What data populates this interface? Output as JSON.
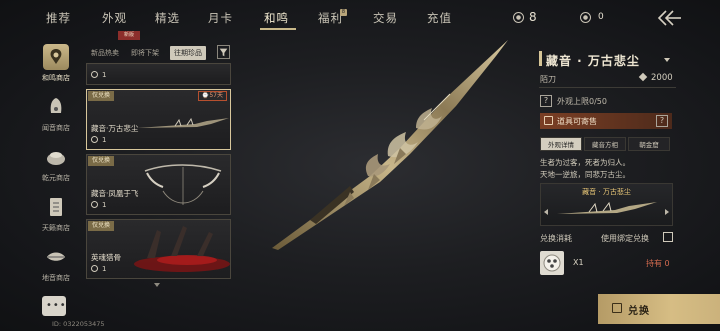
{
  "nav": {
    "tabs": [
      "推荐",
      "外观",
      "精选",
      "月卡",
      "和鸣",
      "福利",
      "交易",
      "充值"
    ],
    "active_tab": "和鸣",
    "welfare_badge": "8",
    "currency_1": {
      "icon": "coin-icon",
      "value": "8"
    },
    "currency_2": {
      "icon": "bean-icon",
      "value": "0"
    },
    "back_icon": "double-chevron-left-icon"
  },
  "sidebar": {
    "shops": [
      "和鸣商店",
      "闻音商店",
      "乾元商店",
      "天籁商店",
      "地音商店"
    ],
    "active": "和鸣商店",
    "uid": "ID: 0322053475"
  },
  "filters": {
    "tag_new": "新版",
    "tabs": [
      "新品热卖",
      "即将下架",
      "往期珍品"
    ],
    "active": "往期珍品"
  },
  "items": [
    {
      "tag": "",
      "name": "",
      "count": "1"
    },
    {
      "tag": "仅兑换",
      "name": "藏音·万古悲尘",
      "count": "1",
      "time": "57天"
    },
    {
      "tag": "仅兑换",
      "name": "藏音·凤凰于飞",
      "count": "1"
    },
    {
      "tag": "仅兑换",
      "name": "英魂猎骨",
      "count": "1"
    }
  ],
  "detail": {
    "title": "藏音 · 万古悲尘",
    "weapon_type": "陌刀",
    "price": "2000",
    "limit_text": "外观上限0/50",
    "tradeable_text": "道具可寄售",
    "sub_tabs": [
      "外观详情",
      "藏音方相",
      "朝金窟"
    ],
    "active_sub_tab": "外观详情",
    "description": [
      "生者为过客，死者为归人。",
      "天地一逆旅，同悲万古尘。"
    ],
    "preview_name": "藏音 · 万古悲尘",
    "cost_label": "兑换消耗",
    "bind_label": "使用绑定兑换",
    "cost_qty": "X1",
    "owned": "持有 0",
    "exchange_button": "兑换"
  },
  "colors": {
    "accent_gold": "#d6bd84",
    "time_badge": "#e5946f",
    "tradeable_bg": "#7b3f24",
    "owned_red": "#d36b4f"
  }
}
